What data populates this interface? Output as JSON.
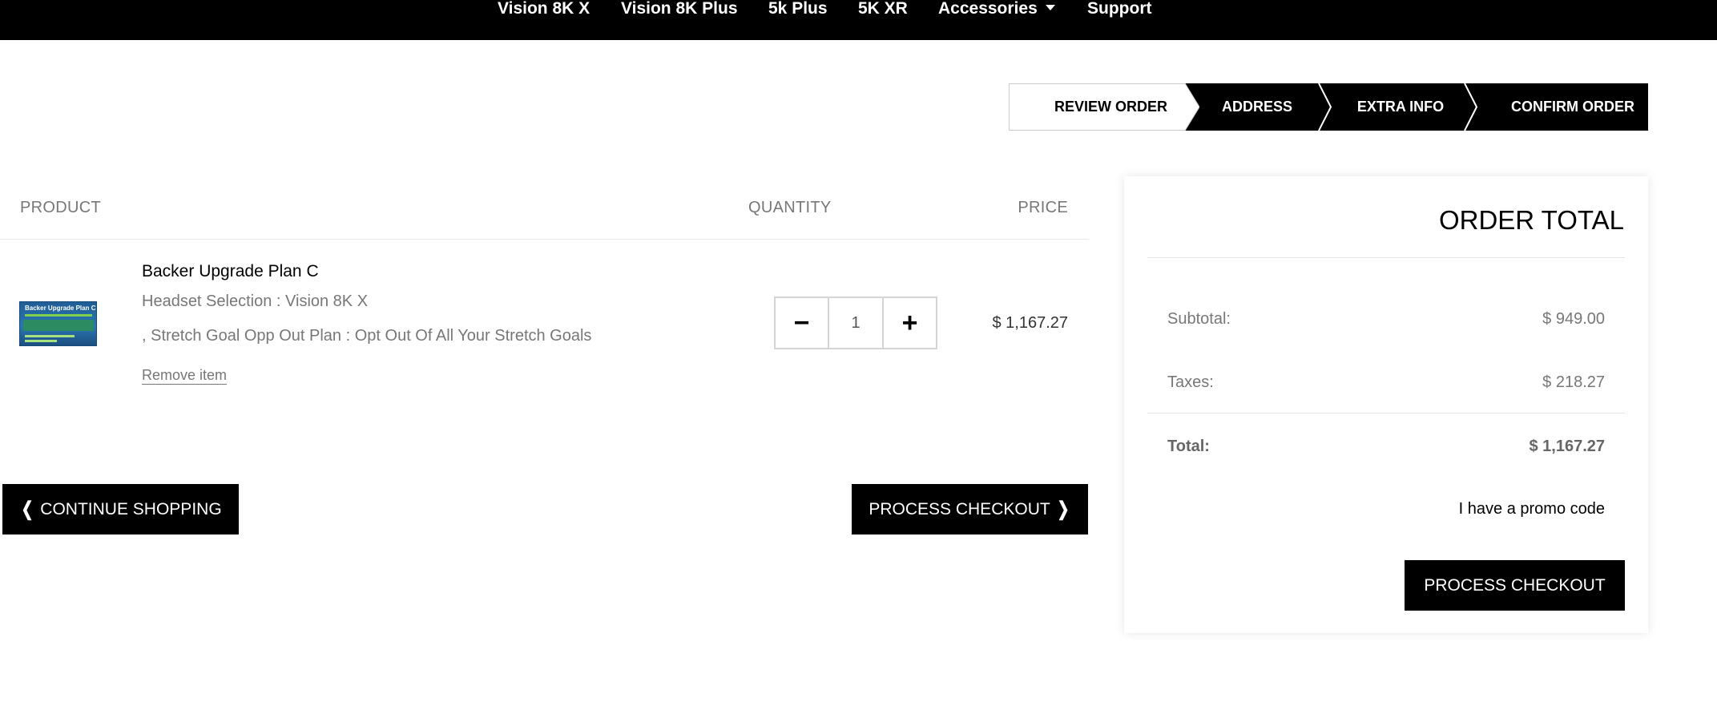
{
  "nav": {
    "items": [
      "Vision 8K X",
      "Vision 8K Plus",
      "5k Plus",
      "5K XR",
      "Accessories",
      "Support"
    ]
  },
  "steps": [
    "REVIEW ORDER",
    "ADDRESS",
    "EXTRA INFO",
    "CONFIRM ORDER"
  ],
  "table": {
    "headers": {
      "product": "PRODUCT",
      "quantity": "QUANTITY",
      "price": "PRICE"
    }
  },
  "product": {
    "name": "Backer Upgrade Plan C",
    "thumb_title": "Backer Upgrade Plan C",
    "attr1_label": "Headset Selection",
    "attr1_value": "Vision 8K X",
    "attr2_prefix": ",",
    "attr2_label": "Stretch Goal Opp Out Plan",
    "attr2_value": "Opt Out Of All Your Stretch Goals",
    "separator": ":",
    "remove_label": "Remove item",
    "quantity": "1",
    "price": "$ 1,167.27"
  },
  "buttons": {
    "continue_shopping": "CONTINUE SHOPPING",
    "process_checkout": "PROCESS CHECKOUT"
  },
  "order_total": {
    "title": "ORDER TOTAL",
    "subtotal_label": "Subtotal:",
    "subtotal_value": "$ 949.00",
    "taxes_label": "Taxes:",
    "taxes_value": "$ 218.27",
    "total_label": "Total:",
    "total_value": "$ 1,167.27",
    "promo_label": "I have a promo code",
    "checkout_label": "PROCESS CHECKOUT"
  }
}
